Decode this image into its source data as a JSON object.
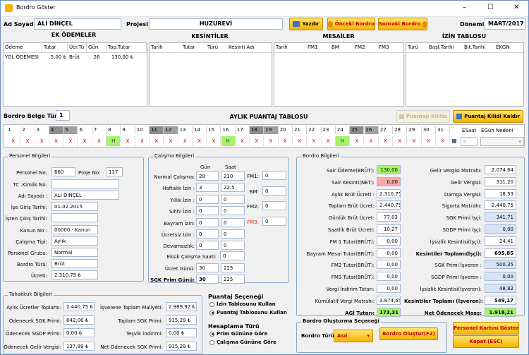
{
  "window": {
    "title": "Bordro Göster",
    "minimize": "–",
    "maximize": "☐",
    "close": "✕"
  },
  "header": {
    "ad_soyad_label": "Ad Soyad:",
    "ad_soyad": "ALİ DİNÇEL",
    "projesi_label": "Projesi:",
    "projesi": "HUZUREVİ",
    "yazdir": "Yazdır",
    "onceki": "Önceki Bordro",
    "sonraki": "Sonraki Bordro",
    "donemi_label": "Dönemi",
    "donemi": "MART/2017"
  },
  "ek_odemeler": {
    "title": "EK ÖDEMELER",
    "columns": [
      "Ödeme",
      "Tutar",
      "Ücr.Tü",
      "Gün",
      "Top.Tutar"
    ],
    "rows": [
      [
        "YOL ÖDEMESİ",
        "5,00 ₺",
        "Brüt",
        "26",
        "130,00 ₺"
      ]
    ]
  },
  "kesintiler": {
    "title": "KESİNTİLER",
    "columns": [
      "Tarih",
      "Tutar",
      "Türü",
      "Kesinti Adı"
    ]
  },
  "mesailer": {
    "title": "MESAİLER",
    "columns": [
      "Tarih",
      "FM1",
      "BM",
      "FM2",
      "FM3"
    ]
  },
  "izin": {
    "title": "İZİN TABLOSU",
    "columns": [
      "Türü",
      "Başl.Tarihi",
      "Bit.Tarihi",
      "EKGN"
    ]
  },
  "puantaj": {
    "belge_label": "Bordro Belge Türü:",
    "belge": "1",
    "title": "AYLIK PUANTAJ TABLOSU",
    "kilitle": "Puantajı Kilitle",
    "kilidi_kaldir": "Puantaj Kilidi Kaldır",
    "days": [
      "1",
      "2",
      "3",
      "4",
      "5",
      "6",
      "7",
      "8",
      "9",
      "10",
      "11",
      "12",
      "13",
      "14",
      "15",
      "16",
      "17",
      "18",
      "19",
      "20",
      "21",
      "22",
      "23",
      "24",
      "25",
      "26",
      "27",
      "28",
      "29",
      "30",
      "31"
    ],
    "cells": [
      "X",
      "X",
      "X",
      "X",
      "X",
      "X",
      "X",
      "H",
      "X",
      "X",
      "X",
      "X",
      "X",
      "X",
      "X",
      "H",
      "X",
      "X",
      "X",
      "X",
      "X",
      "X",
      "X",
      "H",
      "X",
      "X",
      "X",
      "X",
      "X",
      "X",
      "X"
    ],
    "esaat_label": "ESaat",
    "egun_label": "EGün Nedeni",
    "esaat": "0"
  },
  "personel": {
    "title": "Personel Bilgileri",
    "personel_no_label": "Personel No:",
    "personel_no": "660",
    "proje_no_label": "Proje No:",
    "proje_no": "117",
    "tc_label": "TC .Kimlik No:",
    "tc": "",
    "adi_label": "Adı Soyadı :",
    "adi": "ALİ DİNÇEL",
    "giris_label": "İşe Giriş Tarihi:",
    "giris": "01.02.2015",
    "cikis_label": "İşten Çıkış Tarihi:",
    "cikis": "",
    "kanun_label": "Kanun No :",
    "kanun": "00000 - Kanun",
    "calisma_label": "Çalışma Tipi:",
    "calisma": "Aylık",
    "grup_label": "Personel Grubu:",
    "grup": "Normal",
    "bordro_label": "Bordro Türü:",
    "bordro": "Brüt",
    "ucret_label": "Ücreti:",
    "ucret": "2.310,75 ₺"
  },
  "calisma": {
    "title": "Çalışma Bilgileri",
    "gun_h": "Gün",
    "saat_h": "Saat",
    "rows": [
      {
        "l": "Normal Çalışma:",
        "g": "28",
        "s": "210"
      },
      {
        "l": "Haftalık İzin :",
        "g": "3",
        "s": "22.5"
      },
      {
        "l": "Yıllık İzin :",
        "g": "0",
        "s": "0"
      },
      {
        "l": "Sıhhi İzin :",
        "g": "0",
        "s": "0"
      },
      {
        "l": "Bayram İzin:",
        "g": "0",
        "s": "0"
      },
      {
        "l": "Ücretsiz İzin :",
        "g": "0",
        "s": "0"
      },
      {
        "l": "Devamsızlık:",
        "g": "0",
        "s": "0"
      }
    ],
    "eksik_label": "Eksik Çalışma Saati:",
    "eksik": "0",
    "ucret_gunu_label": "Ücret Günü:",
    "ucret_gunu_g": "30",
    "ucret_gunu_s": "225",
    "sgk_label": "SGK Prim Günü:",
    "sgk_g": "30",
    "sgk_s": "225",
    "fm": [
      {
        "l": "FM1:",
        "v": "0"
      },
      {
        "l": "BM:",
        "v": "0"
      },
      {
        "l": "FM2:",
        "v": "0"
      },
      {
        "l": "FM3:",
        "v": "0"
      }
    ]
  },
  "bordro": {
    "title": "Bordro Bilgileri",
    "left": [
      {
        "l": "Sair Ödeme(BRÜT):",
        "v": "130,00"
      },
      {
        "l": "Sair Kesinti(NET):",
        "v": "0,00"
      },
      {
        "l": "Aylık Brüt Ücreti :",
        "v": "2.310,75"
      },
      {
        "l": "Toplam Brüt Ücret:",
        "v": "2.440,75"
      },
      {
        "l": "Günlük Brüt Ücret:",
        "v": "77,03"
      },
      {
        "l": "Saatlik Brüt Ücreti:",
        "v": "10,27"
      },
      {
        "l": "FM 1 Tutar(BRÜT):",
        "v": "0,00"
      },
      {
        "l": "Bayram Mesai Tutar(BRÜT):",
        "v": "0,00"
      },
      {
        "l": "FM2 Tutar(BRÜT):",
        "v": "0,00"
      },
      {
        "l": "FM3 Tutar(BRÜT):",
        "v": "0,00"
      },
      {
        "l": "Vergi İndirim Tutarı:",
        "v": "0,00"
      },
      {
        "l": "Kümülatif Vergi Matrahı:",
        "v": "3.874,65"
      },
      {
        "l": "AGİ Tutarı:",
        "v": "173,31"
      }
    ],
    "right": [
      {
        "l": "Gelir Vergisi Matrahı:",
        "v": "2.074,64"
      },
      {
        "l": "Gelir Vergisi:",
        "v": "311,20"
      },
      {
        "l": "Damga Vergisi:",
        "v": "18,53"
      },
      {
        "l": "Sigorta Matrahı:",
        "v": "2.440,75"
      },
      {
        "l": "SGK Primi İşçi:",
        "v": "341,71"
      },
      {
        "l": "SGDP Primi İşçi:",
        "v": "0,00"
      },
      {
        "l": "İşsizlik Kesintisi(İşçi):",
        "v": "24,41"
      },
      {
        "l": "Kesintiler Toplamı(İşçi):",
        "v": "695,85"
      },
      {
        "l": "SGK Primi İşveren :",
        "v": "500,35"
      },
      {
        "l": "SGDP Primi İşveren :",
        "v": "0,00"
      },
      {
        "l": "İşsizlik Kesintisi(İşveren):",
        "v": "48,82"
      },
      {
        "l": "Kesintiler Toplamı (İşveren):",
        "v": "549,17"
      },
      {
        "l": "Net Ödenecek Maaş:",
        "v": "1.918,21"
      }
    ]
  },
  "tahakkuk": {
    "title": "Tahakkuk Bilgileri",
    "left": [
      {
        "l": "Aylık Ücretler Toplamı:",
        "v": "2.440,75 ₺"
      },
      {
        "l": "Ödenecek SGK Primi:",
        "v": "842,06 ₺"
      },
      {
        "l": "Ödenecek SGDP Primi:",
        "v": "0,00 ₺"
      },
      {
        "l": "Ödenecek Gelir Vergisi:",
        "v": "137,89 ₺"
      }
    ],
    "right": [
      {
        "l": "İşverene Toplam Maliyeti:",
        "v": "2.989,92 ₺"
      },
      {
        "l": "Toplam SGK Primi:",
        "v": "915,29 ₺"
      },
      {
        "l": "Teşvik indirimi:",
        "v": "0,00 ₺"
      },
      {
        "l": "Net Ödenecek SGK Primi:",
        "v": "915,29 ₺"
      }
    ]
  },
  "puantaj_secenegi": {
    "title": "Puantaj Seçeneği",
    "o1": "İzin Tablosunu Kullan",
    "o2": "Puantaj Tablosunu Kullan"
  },
  "hesaplama": {
    "title": "Hesaplama Türü",
    "o1": "Prim Gününe Göre",
    "o2": "Çalışma Gününe Göre"
  },
  "olusturma": {
    "title": "Bordro Oluşturma Seçeneği",
    "turu_label": "Bordro Türü:",
    "turu": "Asıl",
    "olustur": "Bordro Oluştur(F2)"
  },
  "actions": {
    "kart": "Personel Kartını Göster",
    "kapat": "Kapat (ESC)"
  }
}
